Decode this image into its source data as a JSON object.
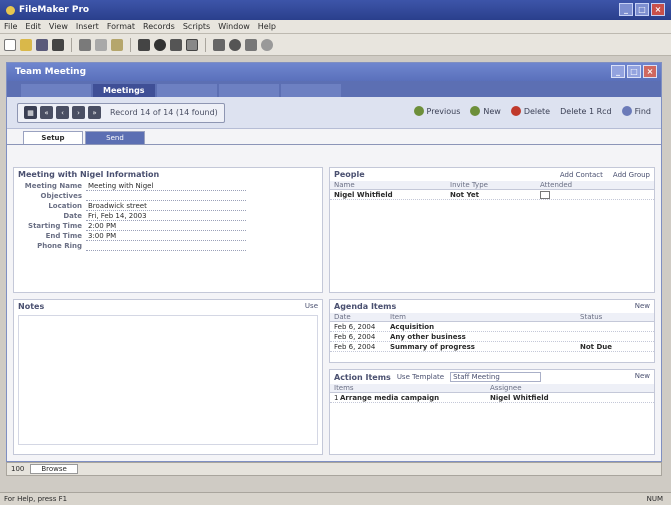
{
  "app": {
    "title": "FileMaker Pro"
  },
  "menu": [
    "File",
    "Edit",
    "View",
    "Insert",
    "Format",
    "Records",
    "Scripts",
    "Window",
    "Help"
  ],
  "document": {
    "title": "Team Meeting"
  },
  "layout_tabs": [
    "",
    "Meetings",
    "",
    "",
    ""
  ],
  "nav": {
    "record_text": "Record 14 of 14 (14 found)"
  },
  "actions": {
    "previous": "Previous",
    "new": "New",
    "delete": "Delete",
    "delete2": "Delete 1 Rcd",
    "find": "Find"
  },
  "sub_tabs": [
    "Setup",
    "Send"
  ],
  "meeting": {
    "section_title": "Meeting with Nigel Information",
    "fields": [
      {
        "label": "Meeting Name",
        "value": "Meeting with Nigel"
      },
      {
        "label": "Objectives",
        "value": ""
      },
      {
        "label": "Location",
        "value": "Broadwick street"
      },
      {
        "label": "Date",
        "value": "Fri, Feb 14, 2003"
      },
      {
        "label": "Starting Time",
        "value": "2:00 PM"
      },
      {
        "label": "End Time",
        "value": "3:00 PM"
      },
      {
        "label": "Phone Ring",
        "value": ""
      }
    ]
  },
  "people": {
    "title": "People",
    "add_contact": "Add Contact",
    "add_group": "Add Group",
    "col_name": "Name",
    "col_invite": "Invite Type",
    "col_attended": "Attended",
    "rows": [
      {
        "name": "Nigel Whitfield",
        "invite": "Not Yet"
      }
    ]
  },
  "notes": {
    "title": "Notes",
    "link": "Use"
  },
  "agenda": {
    "title": "Agenda Items",
    "add": "New",
    "col_date": "Date",
    "col_item": "Item",
    "col_status": "Status",
    "rows": [
      {
        "date": "Feb 6, 2004",
        "item": "Acquisition",
        "status": ""
      },
      {
        "date": "Feb 6, 2004",
        "item": "Any other business",
        "status": ""
      },
      {
        "date": "Feb 6, 2004",
        "item": "Summary of progress",
        "status": "Not Due"
      }
    ]
  },
  "action_items": {
    "title": "Action Items",
    "template_label": "Use Template",
    "template_value": "Staff Meeting",
    "add": "New",
    "col_item": "Items",
    "col_assign": "Assignee",
    "rows": [
      {
        "num": "1",
        "item": "Arrange media campaign",
        "assignee": "Nigel Whitfield"
      }
    ]
  },
  "bottom": {
    "zoom": "100",
    "mode": "Browse"
  },
  "status": {
    "left": "For Help, press F1",
    "right": "NUM"
  }
}
